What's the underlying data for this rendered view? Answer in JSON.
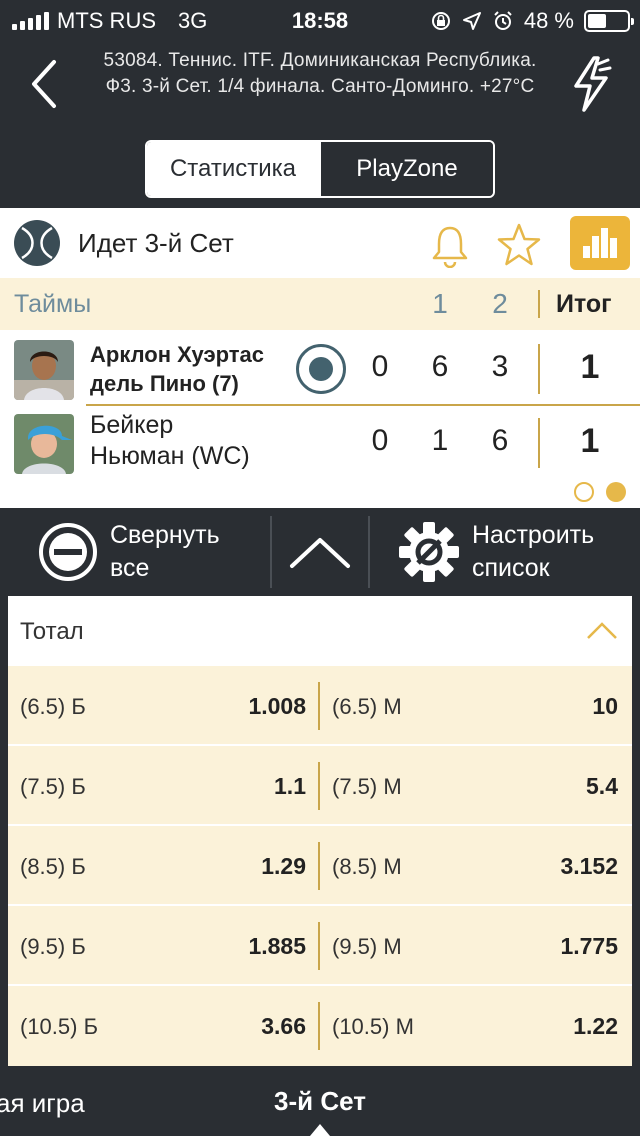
{
  "status_bar": {
    "carrier": "MTS RUS",
    "network": "3G",
    "time": "18:58",
    "battery": "48 %",
    "battery_level": 0.48
  },
  "header": {
    "title": "53084. Теннис. ITF. Доминиканская Республика. Ф3. 3-й  Сет. 1/4 финала. Санто-Доминго. +27°C"
  },
  "tabs": [
    {
      "label": "Статистика",
      "active": true
    },
    {
      "label": "PlayZone",
      "active": false
    }
  ],
  "match": {
    "state": "Идет 3-й  Сет",
    "periods_label": "Таймы",
    "period_numbers": [
      "1",
      "2"
    ],
    "total_label": "Итог",
    "players": [
      {
        "name_line1": "Арклон Хуэртас",
        "name_line2": "дель Пино (7)",
        "scores": [
          "0",
          "6",
          "3"
        ],
        "total": "1",
        "serving": true
      },
      {
        "name_line1": "Бейкер",
        "name_line2": "Ньюман (WC)",
        "scores": [
          "0",
          "1",
          "6"
        ],
        "total": "1",
        "serving": false
      }
    ]
  },
  "toolbar": {
    "collapse_line1": "Свернуть",
    "collapse_line2": "все",
    "settings_line1": "Настроить",
    "settings_line2": "список"
  },
  "market": {
    "title": "Тотал",
    "rows": [
      {
        "over_label": "(6.5) Б",
        "over_odd": "1.008",
        "under_label": "(6.5) М",
        "under_odd": "10"
      },
      {
        "over_label": "(7.5) Б",
        "over_odd": "1.1",
        "under_label": "(7.5) М",
        "under_odd": "5.4"
      },
      {
        "over_label": "(8.5) Б",
        "over_odd": "1.29",
        "under_label": "(8.5) М",
        "under_odd": "3.152"
      },
      {
        "over_label": "(9.5) Б",
        "over_odd": "1.885",
        "under_label": "(9.5) М",
        "under_odd": "1.775"
      },
      {
        "over_label": "(10.5) Б",
        "over_odd": "3.66",
        "under_label": "(10.5) М",
        "under_odd": "1.22"
      }
    ]
  },
  "bottom_nav": {
    "prev_label": "ая игра",
    "current_label": "3-й  Сет"
  },
  "colors": {
    "background": "#2a2e33",
    "accent": "#ecb53a",
    "highlight_bg": "#fbf2d9",
    "period_text": "#6e8c9c"
  }
}
